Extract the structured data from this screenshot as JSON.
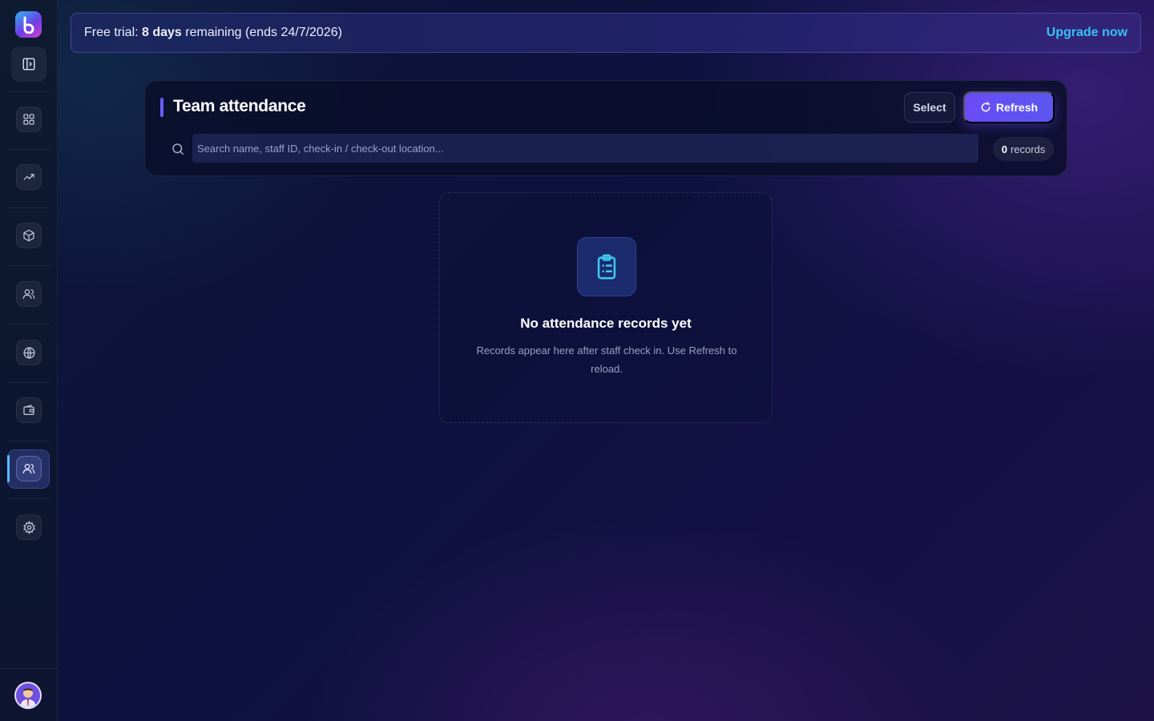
{
  "trial_banner": {
    "prefix": "Free trial: ",
    "days": "8 days",
    "suffix": " remaining (ends 24/7/2026)",
    "upgrade_label": "Upgrade now"
  },
  "sidebar": {
    "logo": "b",
    "toggle_icon": "panel-left-icon",
    "items": [
      {
        "name": "dashboard",
        "icon": "grid-icon"
      },
      {
        "name": "analytics",
        "icon": "trending-up-icon"
      },
      {
        "name": "products",
        "icon": "box-icon"
      },
      {
        "name": "customers",
        "icon": "users-icon"
      },
      {
        "name": "website",
        "icon": "globe-icon"
      },
      {
        "name": "wallet",
        "icon": "wallet-icon"
      },
      {
        "name": "team-attendance",
        "icon": "users-icon",
        "active": true
      },
      {
        "name": "settings",
        "icon": "gear-icon"
      }
    ]
  },
  "attendance": {
    "title": "Team attendance",
    "select_label": "Select",
    "refresh_label": "Refresh",
    "search_placeholder": "Search name, staff ID, check-in / check-out location...",
    "search_value": "",
    "records_count": "0",
    "records_label": "records"
  },
  "empty_state": {
    "icon": "clipboard-list-icon",
    "title": "No attendance records yet",
    "description": "Records appear here after staff check in. Use Refresh to reload."
  },
  "colors": {
    "accent": "#6a4cf6",
    "link": "#35c3f5",
    "active_indicator": "#59b8ff"
  }
}
